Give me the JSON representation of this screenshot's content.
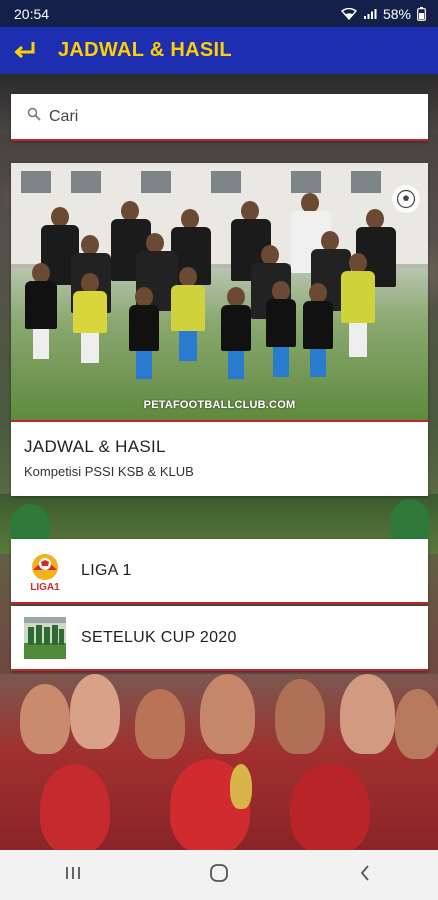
{
  "status_bar": {
    "time": "20:54",
    "battery": "58%"
  },
  "app_bar": {
    "title": "JADWAL & HASIL",
    "back_icon": "back-arrow-icon"
  },
  "search": {
    "placeholder": "Cari",
    "value": ""
  },
  "main_card": {
    "title": "JADWAL & HASIL",
    "subtitle": "Kompetisi PSSI KSB & KLUB",
    "watermark": "PETAFOOTBALLCLUB.COM"
  },
  "competitions": [
    {
      "label": "LIGA 1",
      "logo": "liga1-logo",
      "logo_text": "LIGA1"
    },
    {
      "label": "SETELUK CUP 2020",
      "logo": "seteluk-cup-thumbnail"
    }
  ],
  "nav_bar": {
    "recents_icon": "recents-icon",
    "home_icon": "home-icon",
    "back_icon": "nav-back-icon"
  },
  "colors": {
    "status_bar": "#14204a",
    "app_bar": "#1d2fb0",
    "title_yellow": "#ffd000",
    "accent_red": "#c2262b"
  }
}
